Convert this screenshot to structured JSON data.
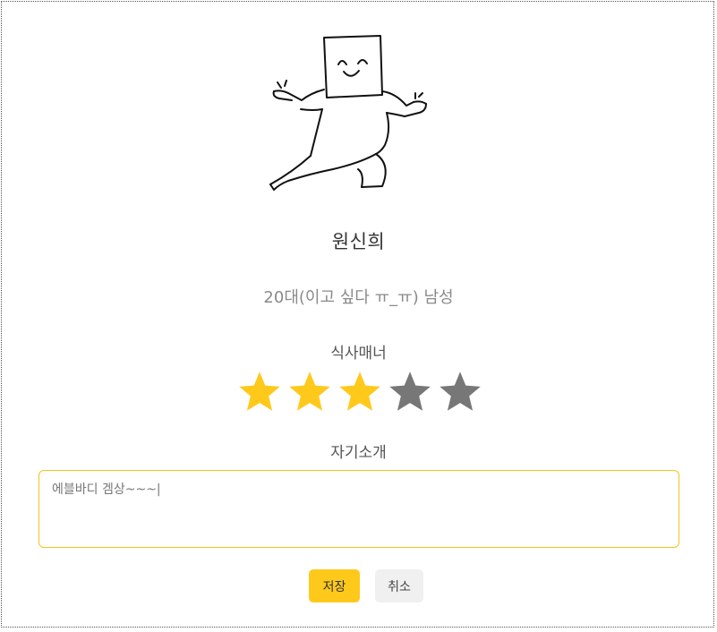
{
  "profile": {
    "name": "원신희",
    "info": "20대(이고 싶다 ㅠ_ㅠ) 남성"
  },
  "manner": {
    "label": "식사매너",
    "rating": 3,
    "max": 5,
    "filled_color": "#ffc91c",
    "empty_color": "#777777"
  },
  "intro": {
    "label": "자기소개",
    "value": "에블바디 겜상~~~|"
  },
  "buttons": {
    "save_label": "저장",
    "cancel_label": "취소"
  },
  "colors": {
    "accent": "#ffc91c",
    "input_border": "#f3c41a"
  }
}
